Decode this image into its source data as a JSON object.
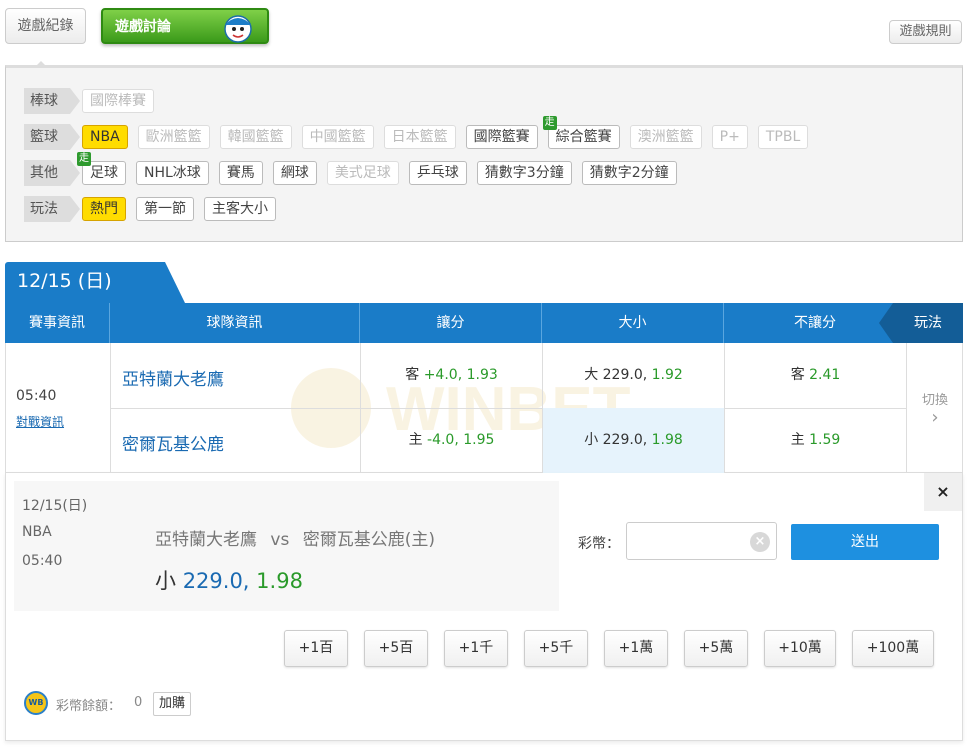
{
  "tabs": {
    "record": "遊戲紀錄",
    "discuss": "遊戲討論"
  },
  "rules_label": "遊戲規則",
  "filters": {
    "baseball": {
      "label": "棒球",
      "items": [
        "國際棒賽"
      ]
    },
    "basketball": {
      "label": "籃球",
      "items": [
        "NBA",
        "歐洲籃籃",
        "韓國籃籃",
        "中國籃籃",
        "日本籃籃",
        "國際籃賽",
        "綜合籃賽",
        "澳洲籃籃",
        "P+",
        "TPBL"
      ]
    },
    "other": {
      "label": "其他",
      "items": [
        "足球",
        "NHL冰球",
        "賽馬",
        "網球",
        "美式足球",
        "乒乓球",
        "猜數字3分鐘",
        "猜數字2分鐘"
      ]
    },
    "play": {
      "label": "玩法",
      "items": [
        "熱門",
        "第一節",
        "主客大小"
      ]
    },
    "badge_go": "走"
  },
  "date_label": "12/15 (日)",
  "table": {
    "headers": {
      "event_info": "賽事資訊",
      "team_info": "球隊資訊",
      "spread": "讓分",
      "total": "大小",
      "moneyline": "不讓分",
      "play": "玩法"
    },
    "time": "05:40",
    "matchup_link": "對戰資訊",
    "teams": [
      "亞特蘭大老鷹",
      "密爾瓦基公鹿"
    ],
    "spread": [
      {
        "side": "客",
        "line": "+4.0",
        "odds": "1.93"
      },
      {
        "side": "主",
        "line": "-4.0",
        "odds": "1.95"
      }
    ],
    "total": [
      {
        "side": "大",
        "line": "229.0",
        "odds": "1.92"
      },
      {
        "side": "小",
        "line": "229.0",
        "odds": "1.98"
      }
    ],
    "moneyline": [
      {
        "side": "客",
        "odds": "2.41"
      },
      {
        "side": "主",
        "odds": "1.59"
      }
    ],
    "switch_label": "切換",
    "switch_arrow": "›",
    "watermark_text": "WINBET"
  },
  "bet": {
    "date": "12/15(日)",
    "league": "NBA",
    "time": "05:40",
    "away": "亞特蘭大老鷹",
    "vs": "vs",
    "home": "密爾瓦基公鹿(主)",
    "pick_side": "小",
    "pick_line": "229.0,",
    "pick_odds": "1.98",
    "close": "×",
    "amount_label": "彩幣：",
    "amount_value": "",
    "clear": "×",
    "submit": "送出",
    "quick_amounts": [
      "+1百",
      "+5百",
      "+1千",
      "+5千",
      "+1萬",
      "+5萬",
      "+10萬",
      "+100萬"
    ],
    "balance_label": "彩幣餘額：",
    "balance_value": "0",
    "topup": "加購",
    "coin_logo_text": "WB"
  },
  "colors": {
    "primary_blue": "#1a7cc8",
    "green_tab": "#3b9a1a",
    "active_yellow": "#ffdc00",
    "odds_green": "#2a9a2a"
  }
}
